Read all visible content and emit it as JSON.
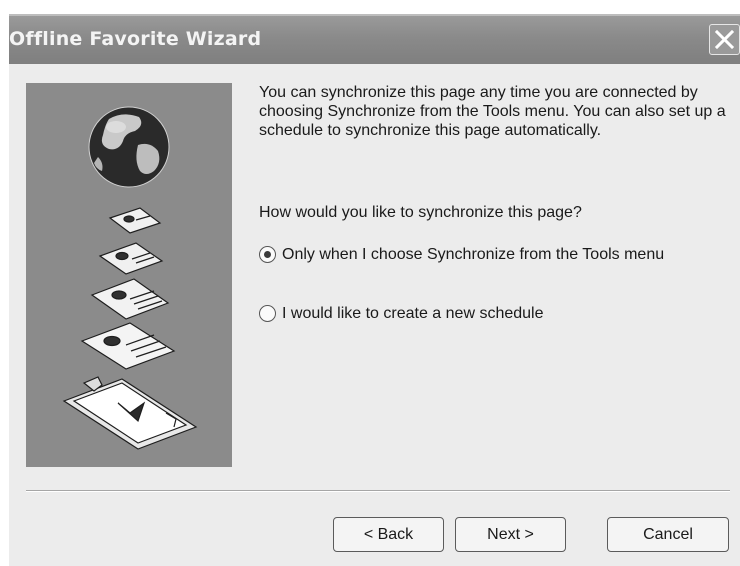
{
  "window": {
    "title": "Offline Favorite Wizard"
  },
  "content": {
    "intro_text": "You can synchronize this page any time you are connected by choosing Synchronize from the Tools menu. You can also set up a schedule to synchronize this page automatically.",
    "question": "How would you like to synchronize this page?",
    "options": [
      {
        "label": "Only when I choose Synchronize from the Tools menu",
        "selected": true
      },
      {
        "label": "I would like to create a new schedule",
        "selected": false
      }
    ]
  },
  "buttons": {
    "back": "< Back",
    "next": "Next >",
    "cancel": "Cancel"
  },
  "colors": {
    "title_bar": "#8a8a8a",
    "dialog_background": "#ececec",
    "art_panel": "#8b8b8b"
  },
  "icons": [
    "close-icon",
    "globe-icon",
    "document-stack-icon"
  ]
}
